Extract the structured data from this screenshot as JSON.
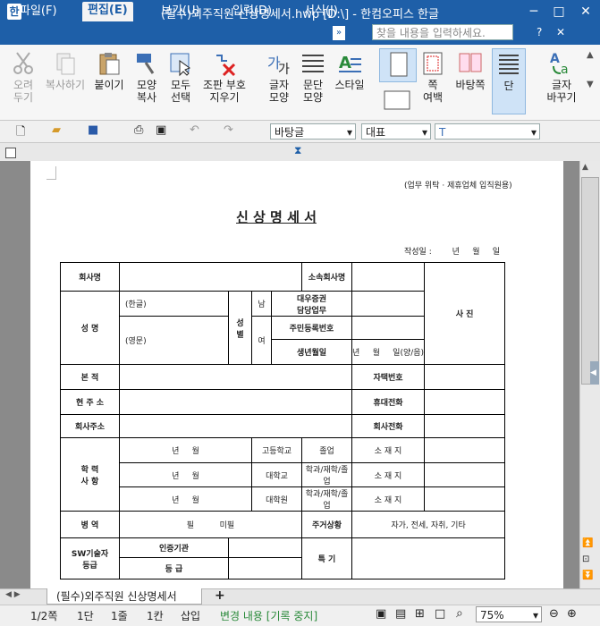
{
  "window": {
    "title": "(필수)외주직원 신상명세서.hwp [D:\\] - 한컴오피스 한글",
    "minimize": "─",
    "maximize": "□",
    "close": "✕"
  },
  "menu": {
    "items": [
      "파일(F)",
      "편집(E)",
      "보기(U)",
      "입력(D)",
      "서식(J)"
    ],
    "active": "편집(E)",
    "search_placeholder": "찾을 내용을 입력하세요."
  },
  "ribbon": {
    "cut": "오려\n두기",
    "copy": "복사하기",
    "paste": "붙이기",
    "format_copy": "모양\n복사",
    "select_all": "모두\n선택",
    "clear_marks": "조판 부호\n지우기",
    "char_shape": "글자\n모양",
    "para_shape": "문단\n모양",
    "style": "스타일",
    "margin": "쪽\n여백",
    "background": "바탕쪽",
    "columns": "단",
    "char_change": "글자\n바꾸기"
  },
  "toolbar": {
    "style": "바탕글",
    "font_lang": "대표",
    "font_icon": "T"
  },
  "document": {
    "usage_note": "(업무 위탁 · 제휴업체 입직원용)",
    "heading": "신 상 명 세 서",
    "date_line": "작성일 :        년     월     일",
    "form": {
      "company": "회사명",
      "affiliated": "소속회사명",
      "photo": "사 진",
      "name": "성 명",
      "korean": "(한글)",
      "english": "(영문)",
      "gender": "성\n별",
      "male": "남",
      "female": "여",
      "dept": "대우증권\n담당업무",
      "rrn": "주민등록번호",
      "birth": "생년월일",
      "birth_val": "년     월     일(양/음)",
      "domicile": "본 적",
      "home_phone": "자택번호",
      "address": "현 주 소",
      "mobile": "휴대전화",
      "company_addr": "회사주소",
      "company_phone": "회사전화",
      "education": "학 력\n사 항",
      "edu_rows": [
        {
          "ym": "년     월",
          "school": "고등학교",
          "status": "졸업",
          "loc": "소 재 지"
        },
        {
          "ym": "년     월",
          "school": "대학교",
          "status": "학과/재학/졸업",
          "loc": "소 재 지"
        },
        {
          "ym": "년     월",
          "school": "대학원",
          "status": "학과/재학/졸업",
          "loc": "소 재 지"
        }
      ],
      "military": "병 역",
      "military_val": "필          미필",
      "housing": "주거상황",
      "housing_val": "자가, 전세, 자취, 기타",
      "it_grade": "SW기술자\n등급",
      "cert_org": "인증기관",
      "grade": "등 급",
      "special": "특 기"
    }
  },
  "tabs": {
    "doc_tab": "(필수)외주직원 신상명세서",
    "add": "+"
  },
  "status": {
    "page": "1/2쪽",
    "col": "1단",
    "line": "1줄",
    "char": "1칸",
    "mode": "삽입",
    "track": "변경 내용 [기록 중지]",
    "zoom": "75%"
  }
}
